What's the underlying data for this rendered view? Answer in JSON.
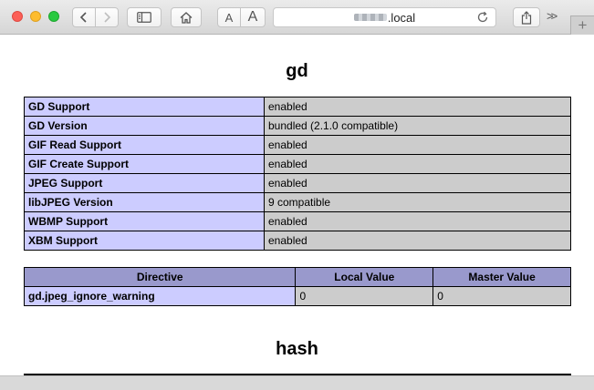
{
  "browser": {
    "font_small_label": "A",
    "font_large_label": "A",
    "address": {
      "host_suffix": ".local"
    },
    "overflow_label": ">>",
    "new_tab_label": "+"
  },
  "sections": [
    {
      "title": "gd",
      "info_rows": [
        {
          "label": "GD Support",
          "value": "enabled"
        },
        {
          "label": "GD Version",
          "value": "bundled (2.1.0 compatible)"
        },
        {
          "label": "GIF Read Support",
          "value": "enabled"
        },
        {
          "label": "GIF Create Support",
          "value": "enabled"
        },
        {
          "label": "JPEG Support",
          "value": "enabled"
        },
        {
          "label": "libJPEG Version",
          "value": "9 compatible"
        },
        {
          "label": "WBMP Support",
          "value": "enabled"
        },
        {
          "label": "XBM Support",
          "value": "enabled"
        }
      ],
      "directives": {
        "headers": [
          "Directive",
          "Local Value",
          "Master Value"
        ],
        "rows": [
          {
            "name": "gd.jpeg_ignore_warning",
            "local": "0",
            "master": "0"
          }
        ]
      }
    },
    {
      "title": "hash"
    }
  ]
}
